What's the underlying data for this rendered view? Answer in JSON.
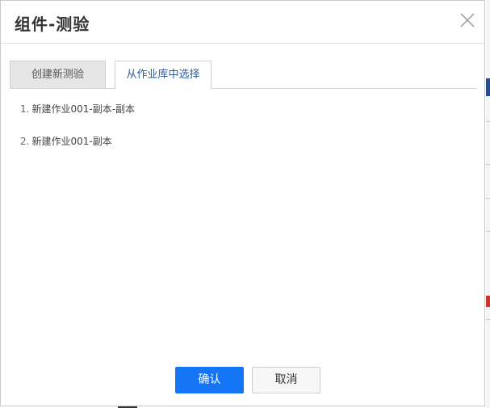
{
  "dialog": {
    "title": "组件-测验",
    "close_icon": "close-icon"
  },
  "tabs": [
    {
      "label": "创建新测验",
      "active": false
    },
    {
      "label": "从作业库中选择",
      "active": true
    }
  ],
  "items": [
    {
      "index": "1.",
      "label": "新建作业001-副本-副本"
    },
    {
      "index": "2.",
      "label": "新建作业001-副本"
    }
  ],
  "buttons": {
    "confirm_label": "确认",
    "cancel_label": "取消"
  },
  "colors": {
    "primary": "#1576f5",
    "active_tab_text": "#2b5a9a"
  }
}
